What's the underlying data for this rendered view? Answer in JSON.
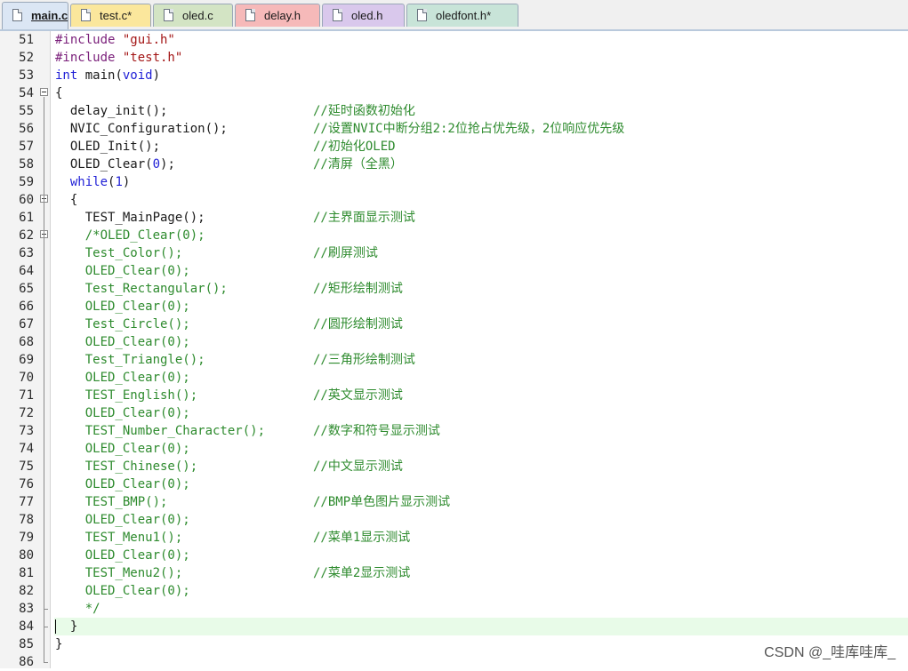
{
  "tabs": [
    {
      "label": "main.c",
      "color": "#dbe6f4",
      "active": true
    },
    {
      "label": "test.c*",
      "color": "#fbe79c"
    },
    {
      "label": "oled.c",
      "color": "#d3e4c4"
    },
    {
      "label": "delay.h",
      "color": "#f6b9b9"
    },
    {
      "label": "oled.h",
      "color": "#d9c8ec"
    },
    {
      "label": "oledfont.h*",
      "color": "#c8e4d8"
    }
  ],
  "colors": {
    "keyword": "#1f1fd6",
    "string": "#a31515",
    "comment": "#2e8b2e",
    "preprocessor": "#7a1f7a",
    "number": "#1f1fd6",
    "function": "#1a1a1a",
    "current_line": "#e8fbe8"
  },
  "lines": [
    {
      "n": "51",
      "code": [
        {
          "t": "#include ",
          "c": "preprocessor"
        },
        {
          "t": "\"gui.h\"",
          "c": "string"
        }
      ]
    },
    {
      "n": "52",
      "code": [
        {
          "t": "#include ",
          "c": "preprocessor"
        },
        {
          "t": "\"test.h\"",
          "c": "string"
        }
      ]
    },
    {
      "n": "53",
      "code": [
        {
          "t": "int",
          "c": "keyword"
        },
        {
          "t": " main(",
          "c": "function"
        },
        {
          "t": "void",
          "c": "keyword"
        },
        {
          "t": ")",
          "c": "function"
        }
      ]
    },
    {
      "n": "54",
      "fold": "open",
      "code": [
        {
          "t": "{",
          "c": "function"
        }
      ]
    },
    {
      "n": "55",
      "code": [
        {
          "t": "  delay_init();",
          "c": "function"
        }
      ],
      "comment": "//延时函数初始化"
    },
    {
      "n": "56",
      "code": [
        {
          "t": "  NVIC_Configuration();",
          "c": "function"
        }
      ],
      "comment": "//设置NVIC中断分组2:2位抢占优先级，2位响应优先级"
    },
    {
      "n": "57",
      "code": [
        {
          "t": "  OLED_Init();",
          "c": "function"
        }
      ],
      "comment": "//初始化OLED"
    },
    {
      "n": "58",
      "code": [
        {
          "t": "  OLED_Clear(",
          "c": "function"
        },
        {
          "t": "0",
          "c": "number"
        },
        {
          "t": ");",
          "c": "function"
        }
      ],
      "comment": "//清屏（全黑）"
    },
    {
      "n": "59",
      "code": [
        {
          "t": "  ",
          "c": "function"
        },
        {
          "t": "while",
          "c": "keyword"
        },
        {
          "t": "(",
          "c": "function"
        },
        {
          "t": "1",
          "c": "number"
        },
        {
          "t": ")",
          "c": "function"
        }
      ]
    },
    {
      "n": "60",
      "fold": "open",
      "code": [
        {
          "t": "  {",
          "c": "function"
        }
      ]
    },
    {
      "n": "61",
      "code": [
        {
          "t": "    TEST_MainPage();",
          "c": "function"
        }
      ],
      "comment": "//主界面显示测试"
    },
    {
      "n": "62",
      "fold": "open",
      "code": [
        {
          "t": "    /*OLED_Clear(0);",
          "c": "comment"
        }
      ]
    },
    {
      "n": "63",
      "code": [
        {
          "t": "    Test_Color();",
          "c": "comment"
        }
      ],
      "comment": "//刷屏测试"
    },
    {
      "n": "64",
      "code": [
        {
          "t": "    OLED_Clear(0);",
          "c": "comment"
        }
      ]
    },
    {
      "n": "65",
      "code": [
        {
          "t": "    Test_Rectangular();",
          "c": "comment"
        }
      ],
      "comment": "//矩形绘制测试"
    },
    {
      "n": "66",
      "code": [
        {
          "t": "    OLED_Clear(0);",
          "c": "comment"
        }
      ]
    },
    {
      "n": "67",
      "code": [
        {
          "t": "    Test_Circle();",
          "c": "comment"
        }
      ],
      "comment": "//圆形绘制测试"
    },
    {
      "n": "68",
      "code": [
        {
          "t": "    OLED_Clear(0);",
          "c": "comment"
        }
      ]
    },
    {
      "n": "69",
      "code": [
        {
          "t": "    Test_Triangle();",
          "c": "comment"
        }
      ],
      "comment": "//三角形绘制测试"
    },
    {
      "n": "70",
      "code": [
        {
          "t": "    OLED_Clear(0);",
          "c": "comment"
        }
      ]
    },
    {
      "n": "71",
      "code": [
        {
          "t": "    TEST_English();",
          "c": "comment"
        }
      ],
      "comment": "//英文显示测试"
    },
    {
      "n": "72",
      "code": [
        {
          "t": "    OLED_Clear(0);",
          "c": "comment"
        }
      ]
    },
    {
      "n": "73",
      "code": [
        {
          "t": "    TEST_Number_Character();",
          "c": "comment"
        }
      ],
      "comment": "//数字和符号显示测试"
    },
    {
      "n": "74",
      "code": [
        {
          "t": "    OLED_Clear(0);",
          "c": "comment"
        }
      ]
    },
    {
      "n": "75",
      "code": [
        {
          "t": "    TEST_Chinese();",
          "c": "comment"
        }
      ],
      "comment": "//中文显示测试"
    },
    {
      "n": "76",
      "code": [
        {
          "t": "    OLED_Clear(0);",
          "c": "comment"
        }
      ]
    },
    {
      "n": "77",
      "code": [
        {
          "t": "    TEST_BMP();",
          "c": "comment"
        }
      ],
      "comment": "//BMP单色图片显示测试"
    },
    {
      "n": "78",
      "code": [
        {
          "t": "    OLED_Clear(0);",
          "c": "comment"
        }
      ]
    },
    {
      "n": "79",
      "code": [
        {
          "t": "    TEST_Menu1();",
          "c": "comment"
        }
      ],
      "comment": "//菜单1显示测试"
    },
    {
      "n": "80",
      "code": [
        {
          "t": "    OLED_Clear(0);",
          "c": "comment"
        }
      ]
    },
    {
      "n": "81",
      "code": [
        {
          "t": "    TEST_Menu2();",
          "c": "comment"
        }
      ],
      "comment": "//菜单2显示测试"
    },
    {
      "n": "82",
      "code": [
        {
          "t": "    OLED_Clear(0);",
          "c": "comment"
        }
      ]
    },
    {
      "n": "83",
      "fold": "end",
      "code": [
        {
          "t": "    */",
          "c": "comment"
        }
      ]
    },
    {
      "n": "84",
      "fold": "end",
      "current": true,
      "code": [
        {
          "t": "  }",
          "c": "function"
        }
      ]
    },
    {
      "n": "85",
      "code": [
        {
          "t": "}",
          "c": "function"
        }
      ]
    },
    {
      "n": "86",
      "fold": "end",
      "code": []
    }
  ],
  "watermark": "CSDN @_哇库哇库_"
}
